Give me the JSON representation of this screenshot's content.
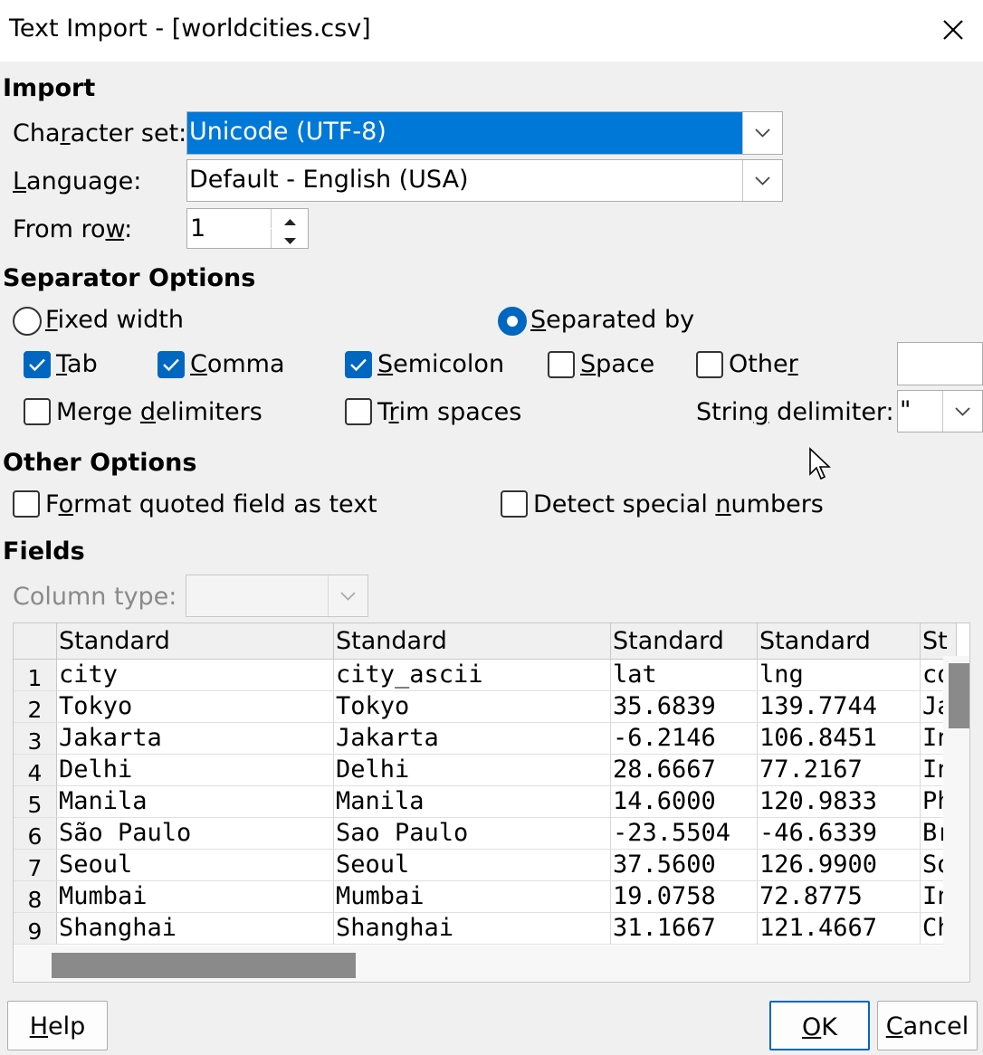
{
  "window": {
    "title": "Text Import - [worldcities.csv]"
  },
  "import": {
    "heading": "Import",
    "charset_label": "Character set:",
    "charset_value": "Unicode (UTF-8)",
    "language_label": "Language:",
    "language_value": "Default - English (USA)",
    "fromrow_label": "From row:",
    "fromrow_value": "1"
  },
  "separator": {
    "heading": "Separator Options",
    "fixed_width": {
      "label": "Fixed width",
      "selected": false
    },
    "separated_by": {
      "label": "Separated by",
      "selected": true
    },
    "tab": {
      "label": "Tab",
      "checked": true
    },
    "comma": {
      "label": "Comma",
      "checked": true
    },
    "semicolon": {
      "label": "Semicolon",
      "checked": true
    },
    "space": {
      "label": "Space",
      "checked": false
    },
    "other": {
      "label": "Other",
      "checked": false,
      "value": ""
    },
    "merge": {
      "label": "Merge delimiters",
      "checked": false
    },
    "trim": {
      "label": "Trim spaces",
      "checked": false
    },
    "string_delim_label": "String delimiter:",
    "string_delim_value": "\""
  },
  "other_options": {
    "heading": "Other Options",
    "format_quoted": {
      "label": "Format quoted field as text",
      "checked": false
    },
    "detect_special": {
      "label": "Detect special numbers",
      "checked": false
    }
  },
  "fields": {
    "heading": "Fields",
    "column_type_label": "Column type:",
    "column_type_value": "",
    "headers": [
      "Standard",
      "Standard",
      "Standard",
      "Standard",
      "St"
    ],
    "rows": [
      [
        "1",
        "city",
        "city_ascii",
        "lat",
        "lng",
        "co"
      ],
      [
        "2",
        "Tokyo",
        "Tokyo",
        "35.6839",
        "139.7744",
        "Ja"
      ],
      [
        "3",
        "Jakarta",
        "Jakarta",
        "-6.2146",
        "106.8451",
        "In"
      ],
      [
        "4",
        "Delhi",
        "Delhi",
        "28.6667",
        "77.2167",
        "In"
      ],
      [
        "5",
        "Manila",
        "Manila",
        "14.6000",
        "120.9833",
        "Ph"
      ],
      [
        "6",
        "São Paulo",
        "Sao Paulo",
        "-23.5504",
        "-46.6339",
        "Br"
      ],
      [
        "7",
        "Seoul",
        "Seoul",
        "37.5600",
        "126.9900",
        "So"
      ],
      [
        "8",
        "Mumbai",
        "Mumbai",
        "19.0758",
        "72.8775",
        "In"
      ],
      [
        "9",
        "Shanghai",
        "Shanghai",
        "31.1667",
        "121.4667",
        "Ch"
      ]
    ]
  },
  "buttons": {
    "help": "Help",
    "ok": "OK",
    "cancel": "Cancel"
  },
  "colors": {
    "accent": "#0067c0",
    "selection": "#0078d7"
  }
}
